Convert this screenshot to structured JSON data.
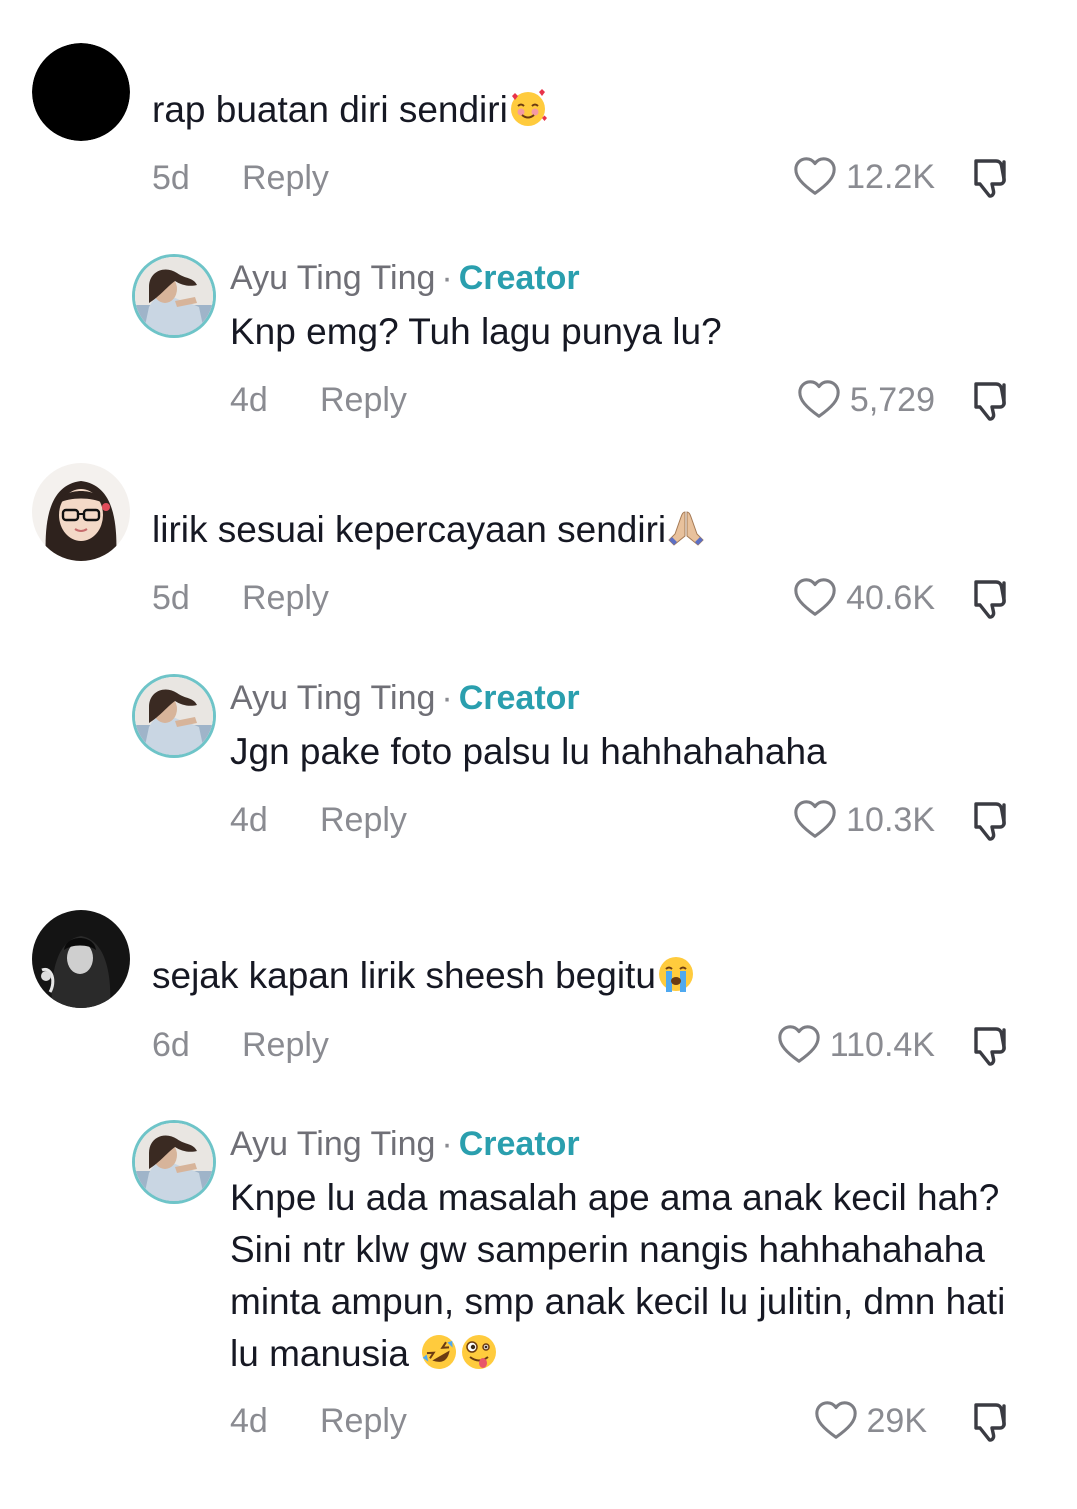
{
  "comments": [
    {
      "text": "rap buatan diri sendiri",
      "emoji": "smiling-face-with-hearts",
      "time": "5d",
      "reply_label": "Reply",
      "likes": "12.2K",
      "reply": {
        "username": "Ayu Ting Ting",
        "separator": "·",
        "badge": "Creator",
        "text": "Knp emg? Tuh lagu punya lu?",
        "time": "4d",
        "reply_label": "Reply",
        "likes": "5,729"
      }
    },
    {
      "text": "lirik sesuai kepercayaan sendiri",
      "emoji": "folded-hands",
      "time": "5d",
      "reply_label": "Reply",
      "likes": "40.6K",
      "reply": {
        "username": "Ayu Ting Ting",
        "separator": "·",
        "badge": "Creator",
        "text": "Jgn pake foto palsu lu hahhahahaha",
        "time": "4d",
        "reply_label": "Reply",
        "likes": "10.3K"
      }
    },
    {
      "text": "sejak kapan lirik sheesh begitu",
      "emoji": "loudly-crying-face",
      "time": "6d",
      "reply_label": "Reply",
      "likes": "110.4K",
      "reply": {
        "username": "Ayu Ting Ting",
        "separator": "·",
        "badge": "Creator",
        "text": "Knpe lu ada masalah ape ama anak kecil hah? Sini ntr klw gw samperin nangis hahhahahaha minta ampun, smp anak kecil lu julitin, dmn hati lu manusia",
        "emoji": "rolling-on-floor-laughing, zany-face",
        "time": "4d",
        "reply_label": "Reply",
        "likes": "29K"
      }
    }
  ],
  "colors": {
    "text": "#161823",
    "muted": "#8a8b91",
    "creator_badge": "#2a9fae",
    "avatar_ring": "#6ec4c8"
  },
  "icons": [
    "heart-outline-icon",
    "dislike-icon"
  ]
}
